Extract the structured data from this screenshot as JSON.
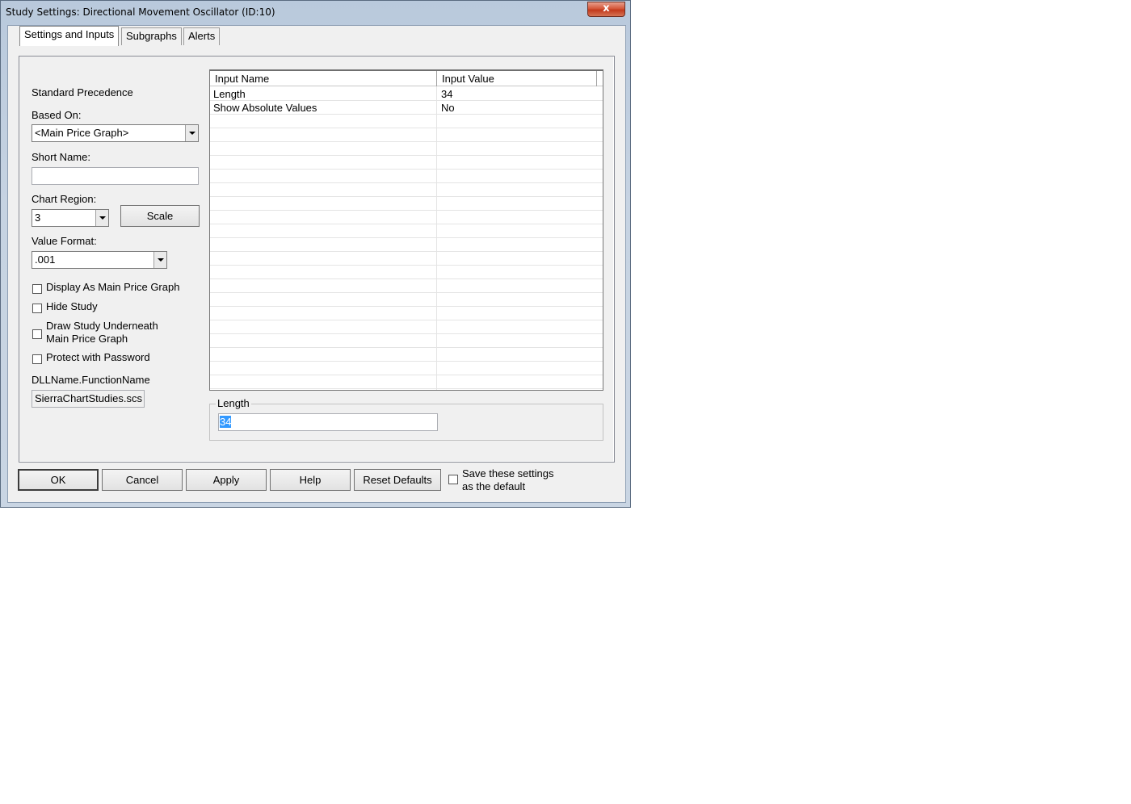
{
  "window": {
    "title": "Study Settings: Directional Movement Oscillator (ID:10)",
    "close_glyph": "x"
  },
  "tabs": [
    {
      "label": "Settings and Inputs",
      "active": true
    },
    {
      "label": "Subgraphs",
      "active": false
    },
    {
      "label": "Alerts",
      "active": false
    }
  ],
  "settings": {
    "standard_precedence": "Standard Precedence",
    "based_on_label": "Based On:",
    "based_on_value": "<Main Price Graph>",
    "short_name_label": "Short Name:",
    "short_name_value": "",
    "chart_region_label": "Chart Region:",
    "chart_region_value": "3",
    "scale_button": "Scale",
    "value_format_label": "Value Format:",
    "value_format_value": ".001",
    "checkboxes": [
      {
        "line1": "Display As Main Price Graph",
        "line2": "",
        "checked": false
      },
      {
        "line1": "Hide Study",
        "line2": "",
        "checked": false
      },
      {
        "line1": "Draw Study Underneath",
        "line2": "Main Price Graph",
        "checked": false
      },
      {
        "line1": "Protect with Password",
        "line2": "",
        "checked": false
      }
    ],
    "dll_label": "DLLName.FunctionName",
    "dll_value": "SierraChartStudies.scs"
  },
  "inputs_grid": {
    "headers": [
      "Input Name",
      "Input Value"
    ],
    "rows": [
      {
        "name": "Length",
        "value": "34"
      },
      {
        "name": "Show Absolute Values",
        "value": "No"
      }
    ]
  },
  "edit_group": {
    "label": "Length",
    "value": "34"
  },
  "buttons": {
    "ok": "OK",
    "cancel": "Cancel",
    "apply": "Apply",
    "help": "Help",
    "reset": "Reset Defaults"
  },
  "save_default": {
    "line1": "Save these settings",
    "line2": "as the default",
    "checked": false
  }
}
